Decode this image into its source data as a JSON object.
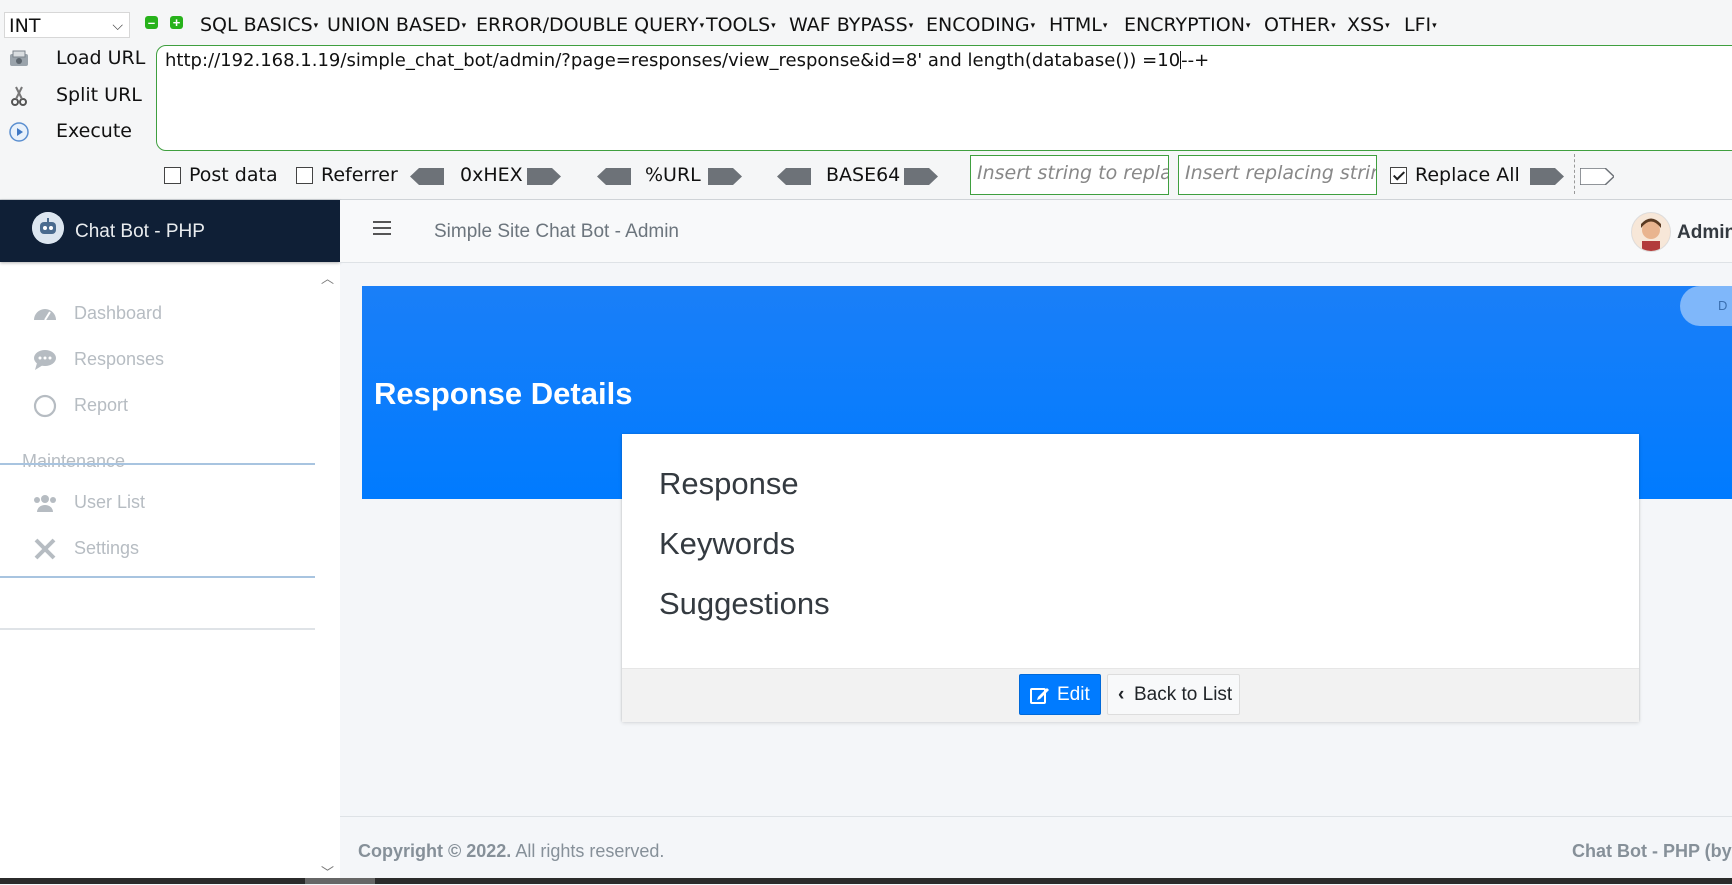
{
  "hackbar": {
    "select_value": "INT",
    "menus": [
      "SQL BASICS",
      "UNION BASED",
      "ERROR/DOUBLE QUERY",
      "TOOLS",
      "WAF BYPASS",
      "ENCODING",
      "HTML",
      "ENCRYPTION",
      "OTHER",
      "XSS",
      "LFI"
    ],
    "buttons": {
      "load": "Load URL",
      "split": "Split URL",
      "execute": "Execute"
    },
    "url_before_caret": "http://192.168.1.19/simple_chat_bot/admin/?page=responses/view_response&id=8' and length(database()) =10",
    "url_after_caret": "--+",
    "post_data": "Post data",
    "referrer": "Referrer",
    "hex": "0xHEX",
    "url_enc": "%URL",
    "base64": "BASE64",
    "replace_placeholder": "Insert string to replace",
    "replacing_placeholder": "Insert replacing string",
    "replace_all": "Replace All",
    "replace_all_checked": true
  },
  "sidebar": {
    "brand": "Chat Bot - PHP",
    "items": [
      {
        "label": "Dashboard",
        "icon": "dashboard-icon"
      },
      {
        "label": "Responses",
        "icon": "comments-icon"
      },
      {
        "label": "Report",
        "icon": "circle-icon"
      }
    ],
    "section_header": "Maintenance",
    "maintenance_items": [
      {
        "label": "User List",
        "icon": "users-icon"
      },
      {
        "label": "Settings",
        "icon": "tools-icon"
      }
    ]
  },
  "topnav": {
    "title": "Simple Site Chat Bot - Admin",
    "user": "Admin"
  },
  "banner": {
    "title": "Response Details",
    "pill_text": "D"
  },
  "card": {
    "rows": [
      "Response",
      "Keywords",
      "Suggestions"
    ],
    "edit_label": "Edit",
    "back_label": "Back to List"
  },
  "footer": {
    "copyright_bold": "Copyright © 2022.",
    "copyright_rest": " All rights reserved.",
    "right": "Chat Bot - PHP (by"
  },
  "colors": {
    "primary": "#007bff",
    "sidebar_brand": "#0f1f36",
    "hackbar_green": "#3f9f3f"
  }
}
